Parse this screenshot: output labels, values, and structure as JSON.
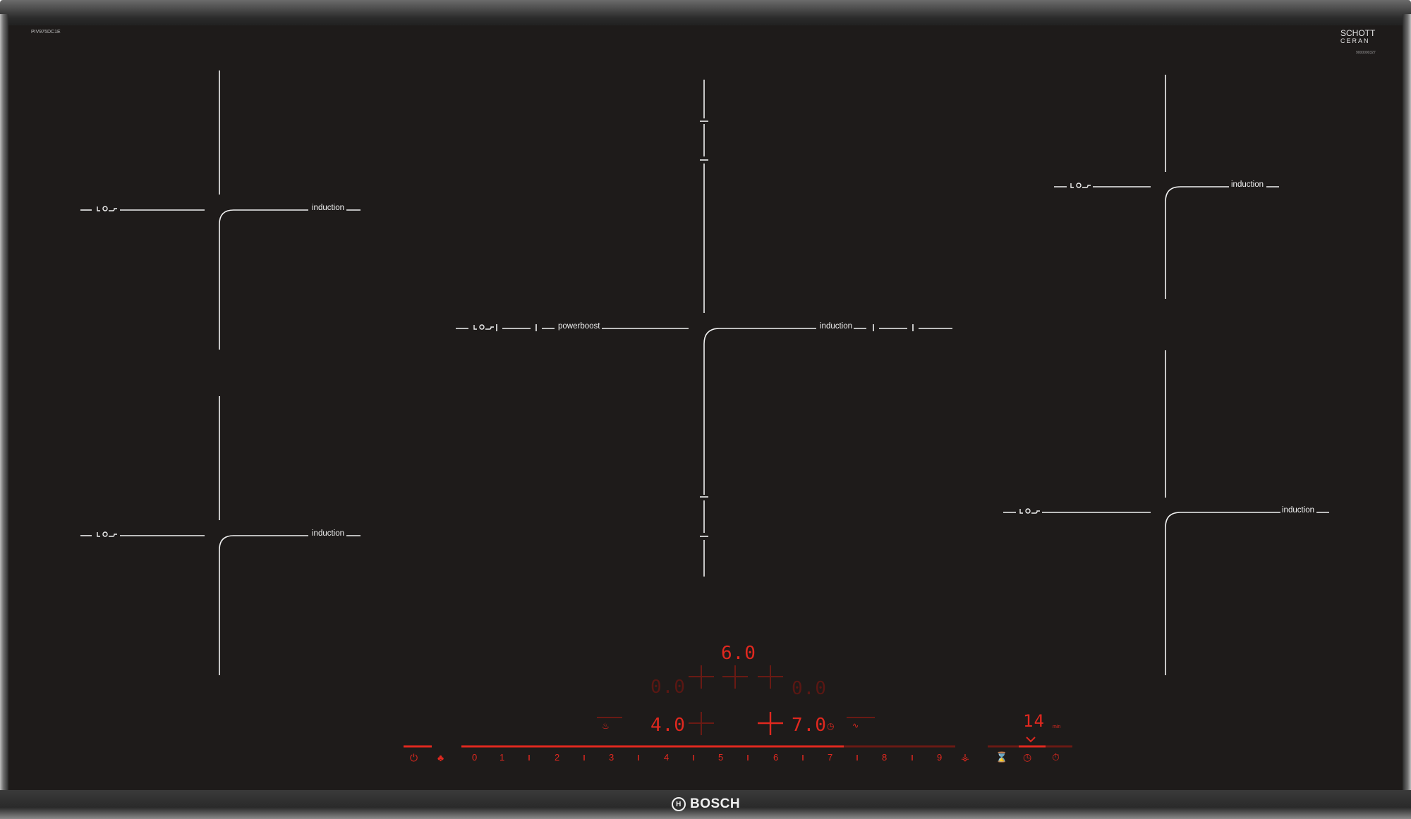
{
  "hob": {
    "model_code": "PIV975DC1E",
    "glass_brand_line1": "SCHOTT",
    "glass_brand_line2": "CERAN",
    "glass_code": "9000000327",
    "brand": "BOSCH"
  },
  "zone_labels": {
    "left_top": "induction",
    "left_bottom": "induction",
    "center_left": "powerboost",
    "center_right": "induction",
    "right_top": "induction",
    "right_bottom": "induction"
  },
  "display": {
    "top": "6.0",
    "mid_left": "0.0",
    "mid_right": "0.0",
    "low_left": "4.0",
    "low_right": "7.0",
    "timer": "14",
    "timer_unit": "min"
  },
  "power_scale": [
    "0",
    "1",
    "2",
    "3",
    "4",
    "5",
    "6",
    "7",
    "8",
    "9"
  ],
  "controls": {
    "power": "power-icon",
    "child_lock": "child-lock-icon",
    "boost": "boost-icon",
    "hourglass": "hourglass-icon",
    "timer": "timer-icon",
    "stopwatch": "stopwatch-icon"
  },
  "colors": {
    "glass": "#1e1b1a",
    "lines": "#f1f1f1",
    "display_red": "#e0281f"
  }
}
